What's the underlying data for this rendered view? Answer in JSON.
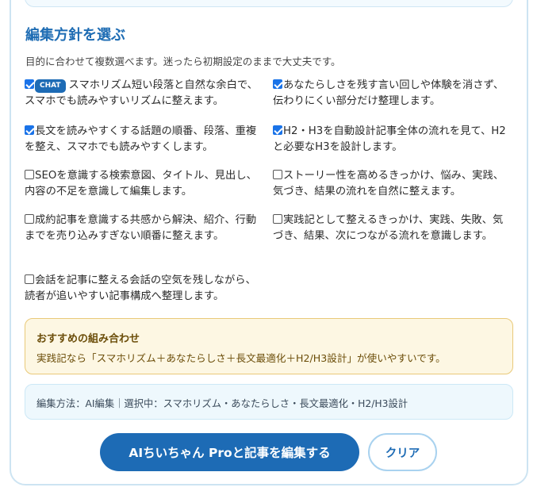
{
  "section": {
    "title": "編集方針を選ぶ",
    "subtitle": "目的に合わせて複数選べます。迷ったら初期設定のままで大丈夫です。"
  },
  "options": [
    {
      "label": "スマホリズム短い段落と自然な余白で、スマホでも読みやすいリズムに整えます。",
      "checked": true,
      "badge": "CHAT"
    },
    {
      "label": "あなたらしさを残す言い回しや体験を消さず、伝わりにくい部分だけ整理します。",
      "checked": true
    },
    {
      "label": "長文を読みやすくする話題の順番、段落、重複を整え、スマホでも読みやすくします。",
      "checked": true
    },
    {
      "label": "H2・H3を自動設計記事全体の流れを見て、H2と必要なH3を設計します。",
      "checked": true
    },
    {
      "label": "SEOを意識する検索意図、タイトル、見出し、内容の不足を意識して編集します。",
      "checked": false
    },
    {
      "label": "ストーリー性を高めるきっかけ、悩み、実践、気づき、結果の流れを自然に整えます。",
      "checked": false
    },
    {
      "label": "成約記事を意識する共感から解決、紹介、行動までを売り込みすぎない順番に整えます。",
      "checked": false
    },
    {
      "label": "実践記として整えるきっかけ、実践、失敗、気づき、結果、次につながる流れを意識します。",
      "checked": false
    },
    {
      "label": "会話を記事に整える会話の空気を残しながら、読者が追いやすい記事構成へ整理します。",
      "checked": false
    }
  ],
  "recommendation": {
    "title": "おすすめの組み合わせ",
    "text": "実践記なら「スマホリズム＋あなたらしさ＋長文最適化＋H2/H3設計」が使いやすいです。"
  },
  "status": {
    "text": "編集方法：AI編集｜選択中：スマホリズム・あなたらしさ・長文最適化・H2/H3設計"
  },
  "buttons": {
    "primary": "AIちいちゃん Proと記事を編集する",
    "clear": "クリア"
  },
  "colors": {
    "accent": "#1d6bb5",
    "title": "#1f6db4",
    "reco_bg": "#fdf7e3",
    "reco_border": "#e9c979",
    "status_bg": "#eef8fd"
  }
}
